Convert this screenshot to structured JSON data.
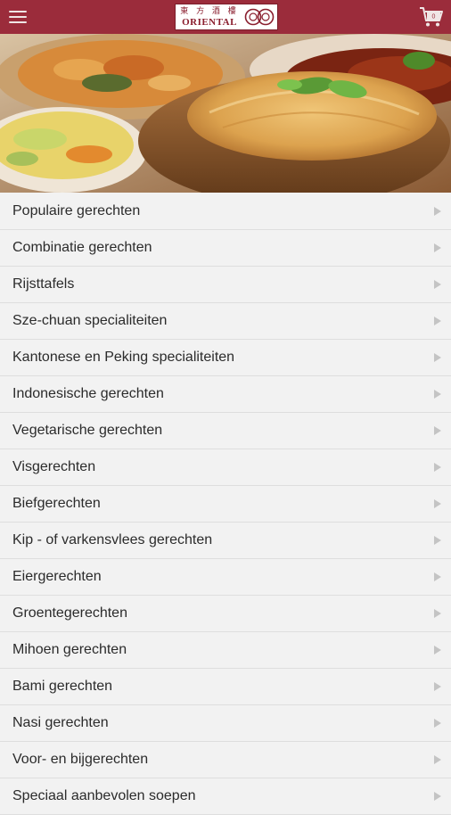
{
  "header": {
    "brand_chinese": "東 方 酒 樓",
    "brand_name": "ORIENTAL",
    "menu_icon": "hamburger-menu-icon",
    "cart_icon": "shopping-cart-icon",
    "cart_count": "0",
    "bar_color": "#9b2c3b"
  },
  "hero": {
    "image": "food-dishes-photo"
  },
  "menu": {
    "chevron_icon": "chevron-right-icon",
    "items": [
      {
        "label": "Populaire gerechten"
      },
      {
        "label": "Combinatie gerechten"
      },
      {
        "label": "Rijsttafels"
      },
      {
        "label": "Sze-chuan specialiteiten"
      },
      {
        "label": "Kantonese en Peking specialiteiten"
      },
      {
        "label": "Indonesische gerechten"
      },
      {
        "label": "Vegetarische gerechten"
      },
      {
        "label": "Visgerechten"
      },
      {
        "label": "Biefgerechten"
      },
      {
        "label": "Kip - of varkensvlees gerechten"
      },
      {
        "label": "Eiergerechten"
      },
      {
        "label": "Groentegerechten"
      },
      {
        "label": "Mihoen gerechten"
      },
      {
        "label": "Bami gerechten"
      },
      {
        "label": "Nasi gerechten"
      },
      {
        "label": "Voor- en bijgerechten"
      },
      {
        "label": "Speciaal aanbevolen soepen"
      }
    ]
  }
}
